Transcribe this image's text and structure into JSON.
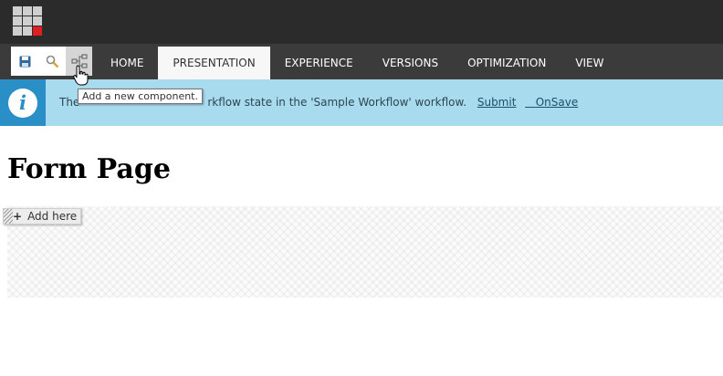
{
  "ribbon": {
    "quick_actions": [
      {
        "icon": "save-icon"
      },
      {
        "icon": "search-icon"
      },
      {
        "icon": "add-component-icon"
      }
    ],
    "tabs": [
      {
        "label": "HOME"
      },
      {
        "label": "PRESENTATION"
      },
      {
        "label": "EXPERIENCE"
      },
      {
        "label": "VERSIONS"
      },
      {
        "label": "OPTIMIZATION"
      },
      {
        "label": "VIEW"
      }
    ],
    "active_tab": "PRESENTATION"
  },
  "tooltip": "Add a new component.",
  "notification": {
    "text_visible": "The",
    "text_rest": "rkflow state in the 'Sample Workflow' workflow.",
    "actions": [
      "Submit",
      "OnSave"
    ]
  },
  "page": {
    "title": "Form Page",
    "add_here": "Add here"
  },
  "colors": {
    "topbar": "#2b2b2b",
    "ribbon": "#3b3b3b",
    "info_bg": "#a8dbee",
    "info_icon": "#2a8fc7",
    "logo_red": "#e02020"
  }
}
